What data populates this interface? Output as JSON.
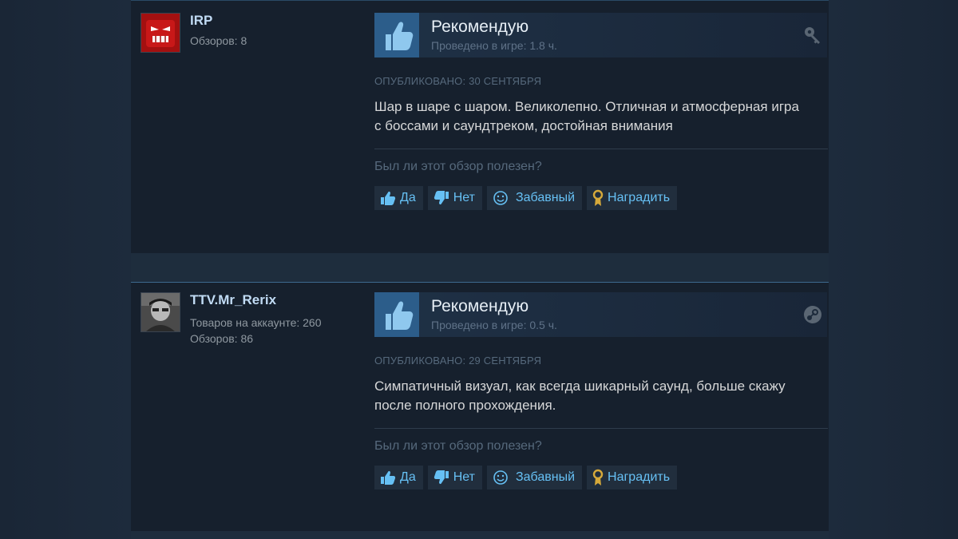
{
  "reviews": [
    {
      "username": "IRP",
      "stats": [
        "Обзоров: 8"
      ],
      "verdict": "Рекомендую",
      "hours": "Проведено в игре: 1.8 ч.",
      "source_icon": "key-icon",
      "posted": "Опубликовано: 30 сентября",
      "text": "Шар в шаре с шаром. Великолепно. Отличная и атмосферная игра с боссами и саундтреком, достойная внимания",
      "helpful_question": "Был ли этот обзор полезен?",
      "buttons": {
        "yes": "Да",
        "no": "Нет",
        "funny": "Забавный",
        "award": "Наградить"
      }
    },
    {
      "username": "TTV.Mr_Rerix",
      "stats": [
        "Товаров на аккаунте: 260",
        "Обзоров: 86"
      ],
      "verdict": "Рекомендую",
      "hours": "Проведено в игре: 0.5 ч.",
      "source_icon": "steam-icon",
      "posted": "Опубликовано: 29 сентября",
      "text": "Симпатичный визуал, как всегда шикарный саунд, больше скажу после полного прохождения.",
      "helpful_question": "Был ли этот обзор полезен?",
      "buttons": {
        "yes": "Да",
        "no": "Нет",
        "funny": "Забавный",
        "award": "Наградить"
      }
    }
  ],
  "colors": {
    "accent": "#66c0f4",
    "panel": "#16202d",
    "page": "#1b2838",
    "award": "#d6a93a"
  }
}
